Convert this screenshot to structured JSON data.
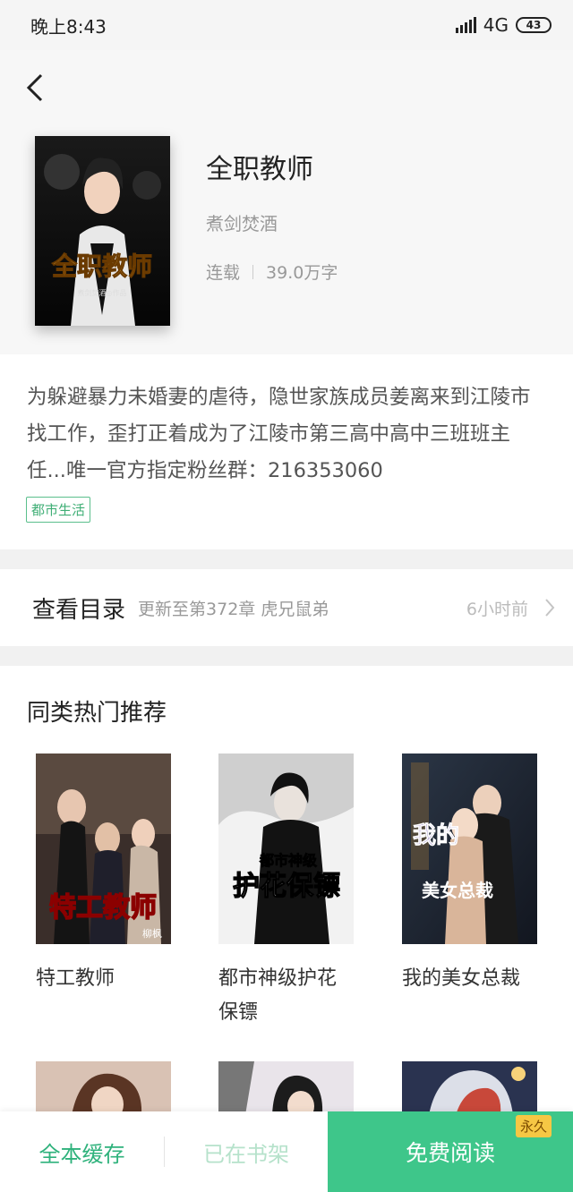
{
  "status_bar": {
    "time": "晚上8:43",
    "network": "4G",
    "battery": "43"
  },
  "book": {
    "title": "全职教师",
    "author": "煮剑焚酒",
    "status": "连载",
    "word_count": "39.0万字",
    "cover_text": {
      "title": "全职教师",
      "credit": "煮剑焚酒◎作品"
    },
    "description": "为躲避暴力未婚妻的虐待，隐世家族成员姜离来到江陵市找工作，歪打正着成为了江陵市第三高中高中三班班主任...唯一官方指定粉丝群：216353060",
    "tag": "都市生活"
  },
  "catalog": {
    "label": "查看目录",
    "latest": "更新至第372章 虎兄鼠弟",
    "time": "6小时前"
  },
  "recommendations": {
    "title": "同类热门推荐",
    "items": [
      {
        "name": "特工教师",
        "cover_text": "特工教师",
        "cover_sub": "柳枫"
      },
      {
        "name": "都市神级护花保镖",
        "cover_text": "护花保镖",
        "cover_sub": "都市神级"
      },
      {
        "name": "我的美女总裁",
        "cover_text": "美女总裁",
        "cover_sub": "我的"
      }
    ]
  },
  "bottom_bar": {
    "cache_label": "全本缓存",
    "shelf_label": "已在书架",
    "read_label": "免费阅读",
    "read_badge": "永久"
  },
  "colors": {
    "accent": "#3ec68a",
    "tag_green": "#3fae75",
    "badge": "#f6c744"
  }
}
